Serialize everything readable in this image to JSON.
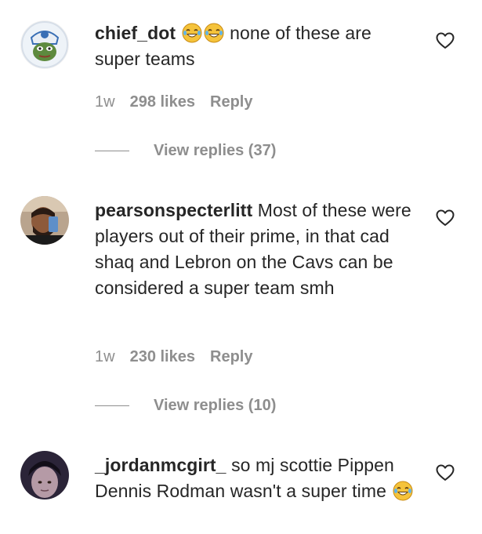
{
  "comments": [
    {
      "username": "chief_dot",
      "emoji_before_text": 2,
      "text": "none of these are super teams",
      "emoji_after_text": 0,
      "time": "1w",
      "likes": "298 likes",
      "reply": "Reply",
      "view_replies": "View replies (37)"
    },
    {
      "username": "pearsonspecterlitt",
      "text": "Most of these were players out of their prime, in that cad shaq and Lebron on the Cavs can be considered a super team smh",
      "time": "1w",
      "likes": "230 likes",
      "reply": "Reply",
      "view_replies": "View replies (10)"
    },
    {
      "username": "_jordanmcgirt_",
      "text": "so mj scottie Pippen Dennis Rodman wasn't a super time",
      "emoji_after_text": 1
    }
  ],
  "icons": {
    "heart": "heart-outline-icon",
    "emoji": "face-with-tears-of-joy-icon"
  },
  "colors": {
    "text": "#262626",
    "secondary": "#8e8e8e"
  }
}
